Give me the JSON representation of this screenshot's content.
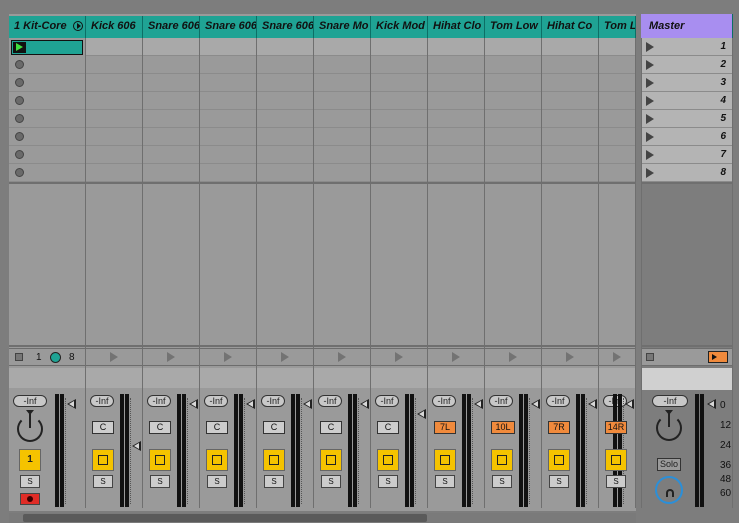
{
  "tracks": [
    {
      "name": "1 Kit-Core",
      "vol": "-Inf",
      "activator": "1",
      "pan": ""
    },
    {
      "name": "Kick 606",
      "vol": "-Inf",
      "pan": "C"
    },
    {
      "name": "Snare 606",
      "vol": "-Inf",
      "pan": "C"
    },
    {
      "name": "Snare 606",
      "vol": "-Inf",
      "pan": "C"
    },
    {
      "name": "Snare 606",
      "vol": "-Inf",
      "pan": "C"
    },
    {
      "name": "Snare Mo",
      "vol": "-Inf",
      "pan": "C"
    },
    {
      "name": "Kick Mod",
      "vol": "-Inf",
      "pan": "C"
    },
    {
      "name": "Hihat Clo",
      "vol": "-Inf",
      "pan": "7L"
    },
    {
      "name": "Tom Low",
      "vol": "-Inf",
      "pan": "10L"
    },
    {
      "name": "Hihat Co",
      "vol": "-Inf",
      "pan": "7R"
    },
    {
      "name": "Tom L",
      "vol": "-Inf",
      "pan": "14R"
    }
  ],
  "master": {
    "name": "Master",
    "vol": "-Inf",
    "solo": "Solo",
    "scenes": [
      "1",
      "2",
      "3",
      "4",
      "5",
      "6",
      "7",
      "8"
    ]
  },
  "group": {
    "num": "1",
    "count": "8"
  },
  "solo_label": "S",
  "meter_scale": [
    "0",
    "12",
    "24",
    "36",
    "48",
    "60"
  ],
  "colors": {
    "track_header": "#1fa394",
    "master_header": "#a88ef0",
    "activator": "#f5c300",
    "pan_offset": "#f08a3c"
  }
}
